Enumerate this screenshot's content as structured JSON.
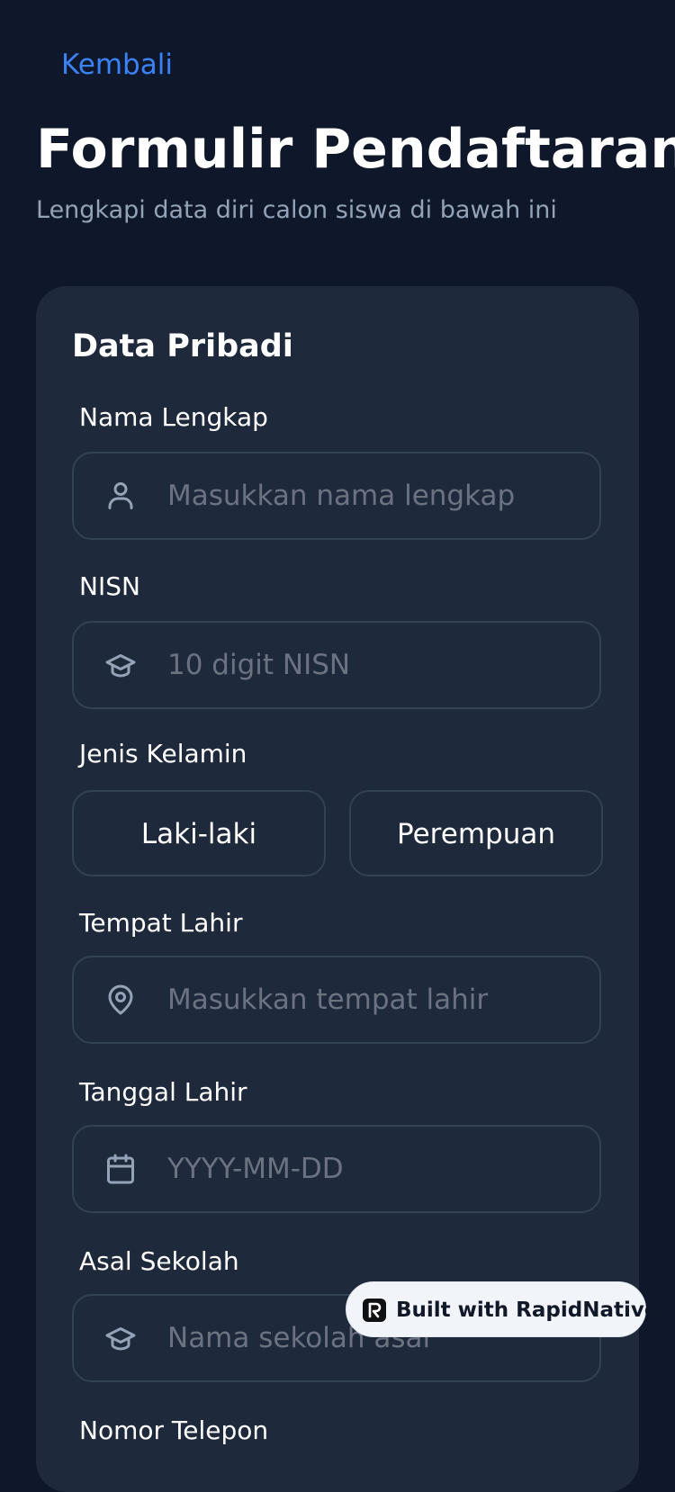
{
  "header": {
    "back_label": "Kembali",
    "title": "Formulir Pendaftaran",
    "subtitle": "Lengkapi data diri calon siswa di bawah ini"
  },
  "form": {
    "section_title": "Data Pribadi",
    "fields": {
      "nama": {
        "label": "Nama Lengkap",
        "placeholder": "Masukkan nama lengkap",
        "value": "",
        "icon": "user-icon"
      },
      "nisn": {
        "label": "NISN",
        "placeholder": "10 digit NISN",
        "value": "",
        "icon": "graduation-cap-icon"
      },
      "tempat_lahir": {
        "label": "Tempat Lahir",
        "placeholder": "Masukkan tempat lahir",
        "value": "",
        "icon": "map-pin-icon"
      },
      "tanggal_lahir": {
        "label": "Tanggal Lahir",
        "placeholder": "YYYY-MM-DD",
        "value": "",
        "icon": "calendar-icon"
      },
      "asal_sekolah": {
        "label": "Asal Sekolah",
        "placeholder": "Nama sekolah asal",
        "value": "",
        "icon": "graduation-cap-icon"
      },
      "telepon": {
        "label": "Nomor Telepon"
      }
    },
    "gender": {
      "label": "Jenis Kelamin",
      "options": [
        "Laki-laki",
        "Perempuan"
      ]
    }
  },
  "badge": {
    "text": "Built with RapidNative",
    "icon": "rapidnative-logo-icon"
  },
  "colors": {
    "background": "#0f172a",
    "card": "#1e293b",
    "border": "#334155",
    "accent": "#3b82f6",
    "muted": "#94a3b8",
    "placeholder": "#6b7280"
  }
}
